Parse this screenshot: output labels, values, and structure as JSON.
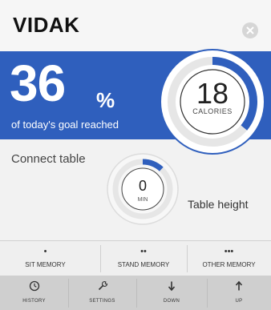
{
  "header": {
    "brand": "VIDAK",
    "close_icon": "close-icon"
  },
  "goal": {
    "percent_value": "36",
    "percent_sign": "%",
    "caption": "of today's goal reached",
    "band_color": "#2f5fbd"
  },
  "calories": {
    "value": "18",
    "label": "CALORIES",
    "progress_fraction": 0.36
  },
  "table": {
    "connect_label": "Connect table",
    "minutes_value": "0",
    "minutes_unit": "MIN",
    "height_label": "Table height",
    "minutes_progress_fraction": 0.12
  },
  "memory": [
    {
      "dots": "•",
      "label": "SIT MEMORY"
    },
    {
      "dots": "••",
      "label": "STAND MEMORY"
    },
    {
      "dots": "•••",
      "label": "OTHER MEMORY"
    }
  ],
  "nav": [
    {
      "label": "HISTORY",
      "icon": "clock-icon"
    },
    {
      "label": "SETTINGS",
      "icon": "wrench-icon"
    },
    {
      "label": "DOWN",
      "icon": "arrow-down-icon"
    },
    {
      "label": "UP",
      "icon": "arrow-up-icon"
    }
  ]
}
